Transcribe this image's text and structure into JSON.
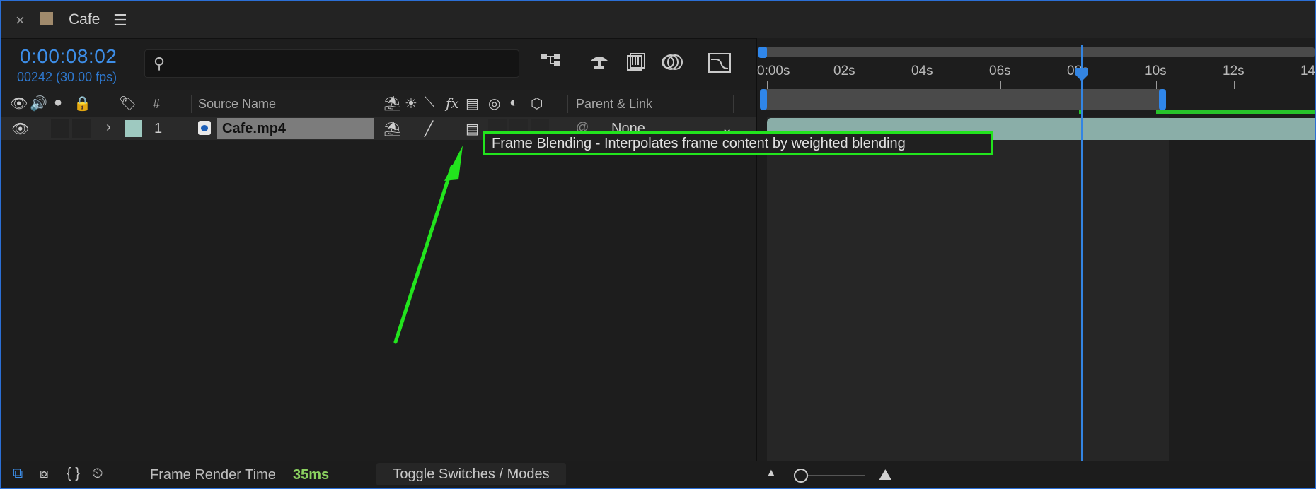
{
  "panel": {
    "title": "Cafe",
    "close_glyph": "×",
    "menu_glyph": "☰",
    "swatch_color": "#a08a6c"
  },
  "timecode": "0:00:08:02",
  "frame_count": "00242 (30.00 fps)",
  "search": {
    "placeholder": "",
    "icon": "search-icon"
  },
  "columns": {
    "number": "#",
    "source_name": "Source Name",
    "parent_link": "Parent & Link"
  },
  "layer": {
    "index": "1",
    "source_name": "Cafe.mp4",
    "label_color": "#9ec9c0",
    "parent": "None"
  },
  "tooltip": "Frame Blending - Interpolates frame content by weighted blending",
  "timeline": {
    "ticks": [
      "0:00s",
      "02s",
      "04s",
      "06s",
      "08s",
      "10s",
      "12s",
      "14"
    ],
    "playhead_time": "0:00:08:02"
  },
  "status": {
    "frame_render_time_label": "Frame Render Time",
    "frame_render_time_value": "35ms",
    "toggle_label": "Toggle Switches / Modes"
  },
  "colors": {
    "accent": "#2f86ea",
    "highlight": "#22e41d",
    "render_time": "#8ad05f"
  }
}
